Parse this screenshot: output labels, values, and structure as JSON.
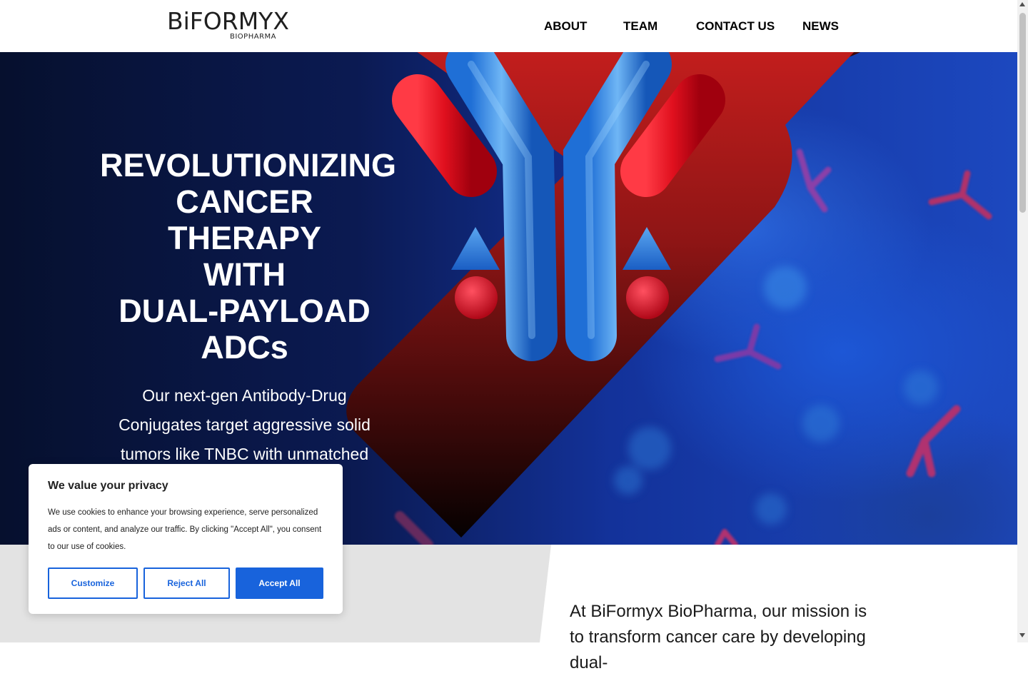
{
  "brand": {
    "logo_text": "BiFORMYX",
    "logo_sub": "BIOPHARMA"
  },
  "nav": {
    "items": [
      {
        "label": "ABOUT"
      },
      {
        "label": "TEAM"
      },
      {
        "label": "CONTACT US"
      },
      {
        "label": "NEWS"
      }
    ]
  },
  "hero": {
    "title_lines": [
      "REVOLUTIONIZING",
      "CANCER THERAPY",
      "WITH",
      "DUAL-PAYLOAD ADCs"
    ],
    "subtitle": "Our next-gen Antibody-Drug Conjugates target aggressive solid tumors like TNBC with unmatched precision and potency."
  },
  "mission": {
    "text": "At BiFormyx BioPharma, our mission is to transform cancer care by developing dual-"
  },
  "cookie_banner": {
    "title": "We value your privacy",
    "body": "We use cookies to enhance your browsing experience, serve personalized ads or content, and analyze our traffic. By clicking \"Accept All\", you consent to our use of cookies.",
    "customize_label": "Customize",
    "reject_label": "Reject All",
    "accept_label": "Accept All"
  },
  "colors": {
    "accent_blue": "#1863dc",
    "brand_red": "#c41e1e",
    "hero_navy": "#0b1a52"
  }
}
